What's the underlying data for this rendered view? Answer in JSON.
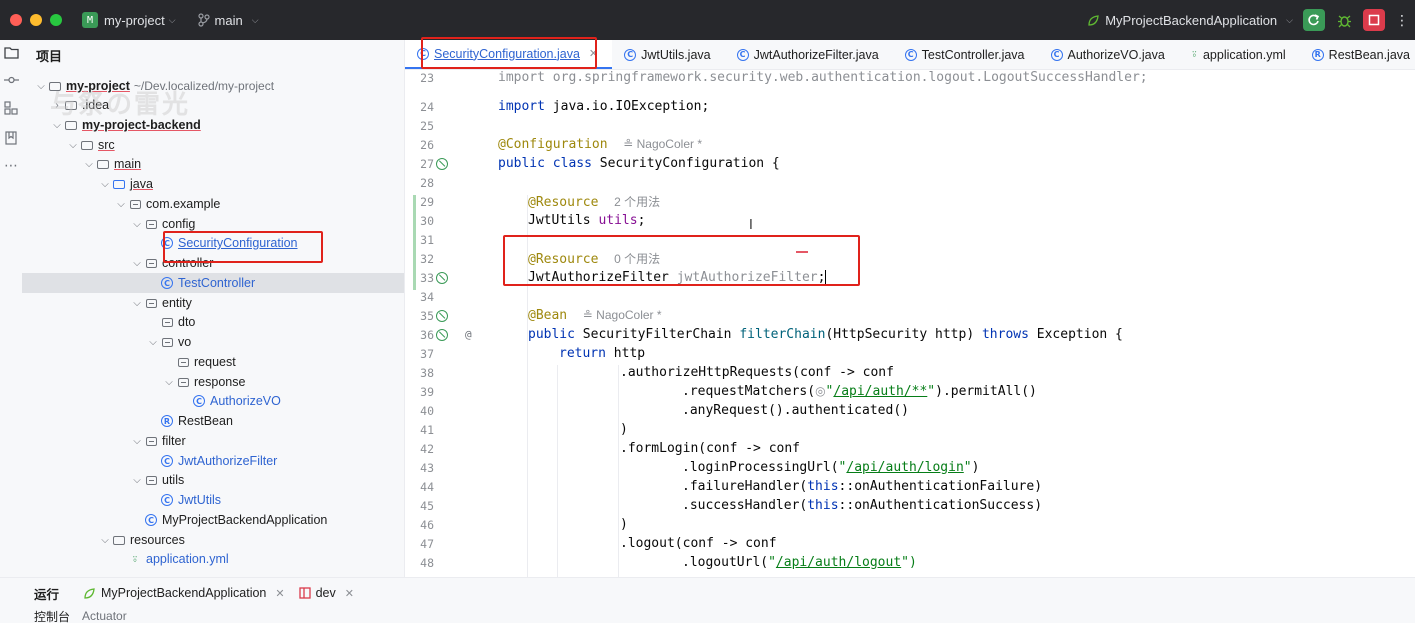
{
  "titlebar": {
    "project_badge": "M",
    "project": "my-project",
    "branch": "main",
    "run_config": "MyProjectBackendApplication"
  },
  "watermark": "与祭の雷光",
  "project_panel": {
    "header": "项目",
    "tree": [
      {
        "label": "my-project",
        "path": "~/Dev.localized/my-project"
      },
      {
        "label": ".idea"
      },
      {
        "label": "my-project-backend"
      },
      {
        "label": "src"
      },
      {
        "label": "main"
      },
      {
        "label": "java"
      },
      {
        "label": "com.example"
      },
      {
        "label": "config"
      },
      {
        "label": "SecurityConfiguration"
      },
      {
        "label": "controller"
      },
      {
        "label": "TestController"
      },
      {
        "label": "entity"
      },
      {
        "label": "dto"
      },
      {
        "label": "vo"
      },
      {
        "label": "request"
      },
      {
        "label": "response"
      },
      {
        "label": "AuthorizeVO"
      },
      {
        "label": "RestBean"
      },
      {
        "label": "filter"
      },
      {
        "label": "JwtAuthorizeFilter"
      },
      {
        "label": "utils"
      },
      {
        "label": "JwtUtils"
      },
      {
        "label": "MyProjectBackendApplication"
      },
      {
        "label": "resources"
      },
      {
        "label": "application.yml"
      }
    ]
  },
  "editor_tabs": [
    {
      "label": "SecurityConfiguration.java",
      "active": true
    },
    {
      "label": "JwtUtils.java"
    },
    {
      "label": "JwtAuthorizeFilter.java"
    },
    {
      "label": "TestController.java"
    },
    {
      "label": "AuthorizeVO.java"
    },
    {
      "label": "application.yml"
    },
    {
      "label": "RestBean.java"
    }
  ],
  "editor": {
    "line_numbers": [
      "23",
      "24",
      "25",
      "26",
      "27",
      "28",
      "29",
      "30",
      "31",
      "32",
      "33",
      "34",
      "35",
      "36",
      "37",
      "38",
      "39",
      "40",
      "41",
      "42",
      "43",
      "44",
      "45",
      "46",
      "47",
      "48"
    ],
    "line23": "import org.springframework.security.web.authentication.logout.LogoutSuccessHandler;",
    "line24_kw": "import",
    "line24_rest": " java.io.IOException;",
    "line26_ann": "@Configuration",
    "line26_hint": "≗ NagoColer *",
    "line27_kw": "public class",
    "line27_rest": " SecurityConfiguration {",
    "line29_ann": "@Resource",
    "line29_hint": "2 个用法",
    "line30_type": "JwtUtils ",
    "line30_field": "utils",
    "line30_end": ";",
    "line32_ann": "@Resource",
    "line32_hint": "0 个用法",
    "line33_type": "JwtAuthorizeFilter ",
    "line33_field": "jwtAuthorizeFilter",
    "line33_end": ";",
    "line35_ann": "@Bean",
    "line35_hint": "≗ NagoColer *",
    "line36_kw1": "public",
    "line36_a": " SecurityFilterChain ",
    "line36_fn": "filterChain",
    "line36_b": "(HttpSecurity http) ",
    "line36_kw2": "throws",
    "line36_c": " Exception {",
    "line37_kw": "return",
    "line37_rest": " http",
    "line38": ".authorizeHttpRequests(conf -> conf",
    "line39_a": ".requestMatchers(",
    "line39_icon": "◎",
    "line39_q1": "\"",
    "line39_url": "/api/auth/**",
    "line39_q2": "\"",
    "line39_b": ").permitAll()",
    "line40": ".anyRequest().authenticated()",
    "line41": ")",
    "line42": ".formLogin(conf -> conf",
    "line43_a": ".loginProcessingUrl(",
    "line43_q1": "\"",
    "line43_url": "/api/auth/login",
    "line43_q2": "\"",
    "line43_b": ")",
    "line44_a": ".failureHandler(",
    "line44_kw": "this",
    "line44_b": "::onAuthenticationFailure)",
    "line45_a": ".successHandler(",
    "line45_kw": "this",
    "line45_b": "::onAuthenticationSuccess)",
    "line46": ")",
    "line47": ".logout(conf -> conf",
    "line48_a": ".logoutUrl(",
    "line48_q1": "\"",
    "line48_url": "/api/auth/logout",
    "line48_q2": "\")",
    "gutter_at": "@"
  },
  "bottom": {
    "label": "运行",
    "tabs": [
      {
        "label": "MyProjectBackendApplication"
      },
      {
        "label": "dev"
      }
    ],
    "sub_label": "控制台",
    "sub_item": "Actuator"
  },
  "colors": {
    "highlight": "#e0221b",
    "accent": "#3574f0",
    "titlebar": "#27282c"
  }
}
